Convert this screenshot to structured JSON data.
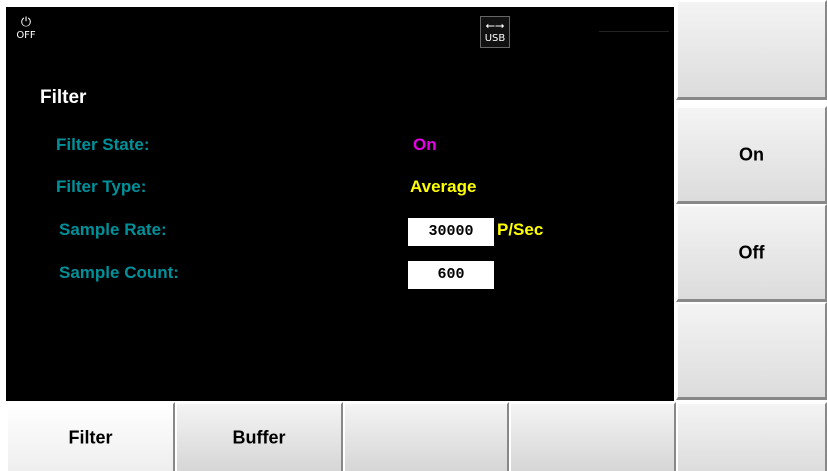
{
  "status_bar": {
    "power_icon": "power-icon",
    "power_label": "OFF",
    "usb_icon": "usb-icon",
    "usb_label": "USB"
  },
  "page": {
    "title": "Filter",
    "fields": {
      "filter_state": {
        "label": "Filter State:",
        "value": "On"
      },
      "filter_type": {
        "label": "Filter Type:",
        "value": "Average"
      },
      "sample_rate": {
        "label": "Sample Rate:",
        "value": "30000",
        "unit": "P/Sec"
      },
      "sample_count": {
        "label": "Sample Count:",
        "value": "600"
      }
    }
  },
  "side_softkeys": [
    "",
    "On",
    "Off",
    "",
    ""
  ],
  "bottom_softkeys": [
    "Filter",
    "Buffer",
    "",
    "",
    ""
  ],
  "colors": {
    "label": "#00909a",
    "state_value": "#e600e6",
    "type_value": "#ffff00",
    "unit": "#ffff00",
    "display_background": "#000000"
  }
}
